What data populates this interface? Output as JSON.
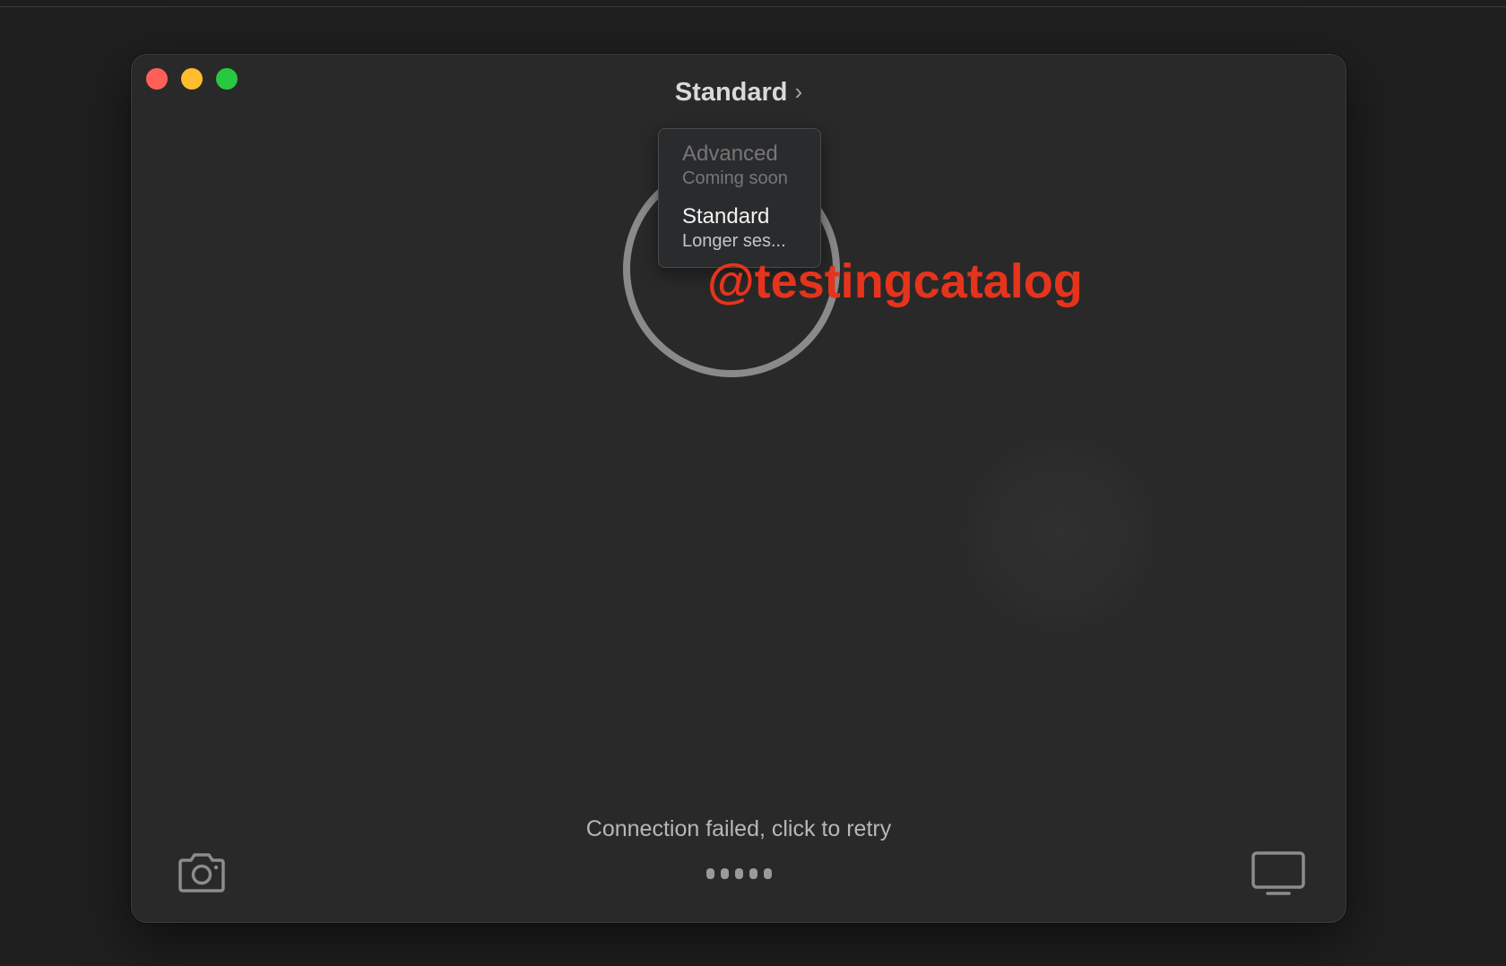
{
  "window": {
    "mode_title": "Standard",
    "mode_chevron": "›"
  },
  "mode_menu": {
    "items": [
      {
        "label": "Advanced",
        "subtitle": "Coming soon",
        "enabled": false
      },
      {
        "label": "Standard",
        "subtitle": "Longer ses...",
        "enabled": true
      }
    ]
  },
  "watermark": "@testingcatalog",
  "status": {
    "message": "Connection failed, click to retry"
  },
  "icons": {
    "left": "camera-icon",
    "right": "monitor-icon"
  },
  "colors": {
    "close": "#fe5f57",
    "minimize": "#febc2e",
    "maximize": "#28c840",
    "watermark": "#e6341c"
  }
}
